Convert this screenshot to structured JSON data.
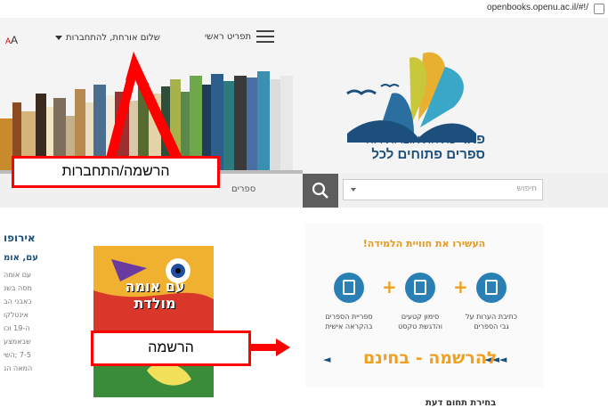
{
  "browser": {
    "url": "openbooks.openu.ac.il/#!/"
  },
  "header": {
    "font_size_label": "A",
    "font_size_small": "A",
    "user_menu": "שלום אורחת, להתחברות",
    "main_menu": "תפריט ראשי",
    "logo_brand": "פאר",
    "logo_tagline": "פתיחת אוצרות רוח",
    "logo_subtitle": "ספרים פתוחים לכל"
  },
  "search": {
    "placeholder": "חיפוש",
    "books_tab": "ספרים"
  },
  "article": {
    "heading": "אירופו",
    "subheading": "עם, אומ",
    "lines": [
      "עם אומה",
      "מסה בשנ",
      "כאבני הב",
      "אינטלקו",
      "ה-19 וכו",
      "שבאמצע",
      "7-5 ;השי",
      "המאה הנ"
    ]
  },
  "cover": {
    "title": "עם אומה מולדת"
  },
  "promo": {
    "title": "העשירו את חוויית הלמידה!",
    "features": [
      {
        "caption": "כתיבת הערות על גבי הספרים"
      },
      {
        "caption": "סימון קטעים והדגשת טקסט"
      },
      {
        "caption": "ספריית הספרים בהקראה אישית"
      }
    ],
    "plus": "+",
    "register_text": "להרשמה - בחינם",
    "arrow_right": "◄◄◄",
    "arrow_left": "◄"
  },
  "section": {
    "heading": "בחירת תחום דעת"
  },
  "annotations": {
    "login_label": "הרשמה/התחברות",
    "register_label": "הרשמה"
  },
  "colors": {
    "annotation_red": "#ff0000",
    "brand_blue": "#1d4f7c",
    "accent_orange": "#f0a020",
    "icon_blue": "#2a7fb5"
  }
}
